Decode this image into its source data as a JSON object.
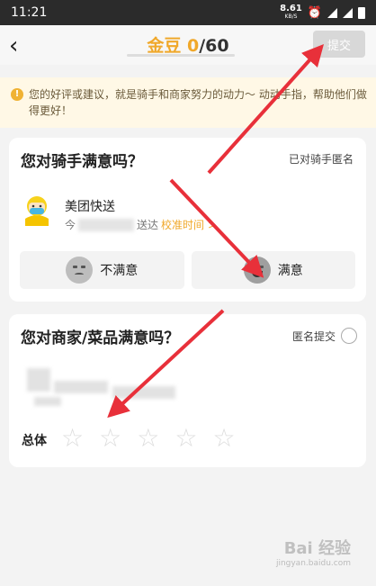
{
  "status_bar": {
    "time": "11:21",
    "net_speed": "8.61",
    "net_unit": "KB/S"
  },
  "header": {
    "title_prefix": "金豆 ",
    "title_count": "0",
    "title_total": "/60",
    "submit_label": "提交",
    "back_icon": "chevron-left-icon"
  },
  "notice": {
    "icon": "info-icon",
    "text": "您的好评或建议，就是骑手和商家努力的动力～ 动动手指，帮助他们做得更好！"
  },
  "rider_section": {
    "title": "您对骑手满意吗？",
    "anonymous_label": "已对骑手匿名",
    "rider_name": "美团快送",
    "delivery_prefix": "今",
    "delivery_suffix": "送达",
    "calibrate_label": "校准时间 >",
    "unsatisfied_label": "不满意",
    "satisfied_label": "满意"
  },
  "merchant_section": {
    "title": "您对商家/菜品满意吗？",
    "anonymous_label": "匿名提交",
    "total_label": "总体",
    "stars": [
      "☆",
      "☆",
      "☆",
      "☆",
      "☆"
    ],
    "rating": 0
  },
  "watermark": {
    "text": "Bai 经验",
    "sub": "jingyan.baidu.com"
  },
  "colors": {
    "accent": "#f0a82a",
    "arrow": "#e8303a"
  }
}
